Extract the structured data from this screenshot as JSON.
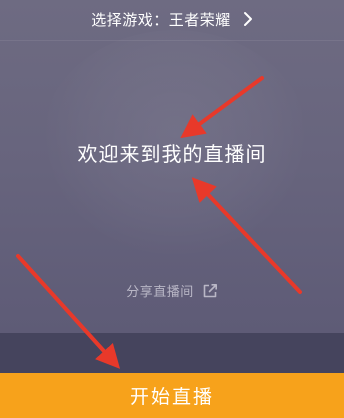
{
  "header": {
    "game_select_label": "选择游戏：王者荣耀"
  },
  "main": {
    "welcome_text": "欢迎来到我的直播间",
    "share_label": "分享直播间"
  },
  "footer": {
    "start_button_label": "开始直播",
    "start_button_color": "#f7a21b"
  },
  "annotations": {
    "arrow_color": "#e8392a"
  },
  "icons": [
    "chevron-right-icon",
    "share-external-icon"
  ]
}
